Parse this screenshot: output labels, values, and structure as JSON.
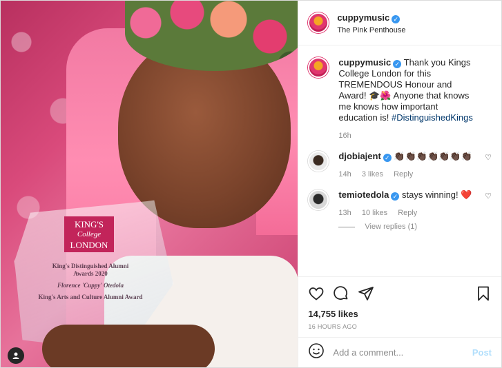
{
  "header": {
    "username": "cuppymusic",
    "location": "The Pink Penthouse"
  },
  "photo": {
    "kings_lines": [
      "KING'S",
      "College",
      "LONDON"
    ],
    "plate_lines": [
      "King's Distinguished Alumni",
      "Awards 2020",
      "Florence 'Cuppy' Otedola",
      "King's Arts and Culture Alumni Award"
    ]
  },
  "caption": {
    "username": "cuppymusic",
    "text": "Thank you Kings College London for this TREMENDOUS Honour and Award! 🎓🌺 Anyone that knows me knows how important education is!",
    "hashtag": "#DistinguishedKings",
    "time": "16h"
  },
  "comments": [
    {
      "username": "djobiajent",
      "text": "👏🏿👏🏿👏🏿👏🏿👏🏿👏🏿👏🏿",
      "time": "14h",
      "likes": "3 likes",
      "reply": "Reply"
    },
    {
      "username": "temiotedola",
      "text": "stays winning! ❤️",
      "time": "13h",
      "likes": "10 likes",
      "reply": "Reply",
      "view_replies": "View replies (1)"
    }
  ],
  "actions": {
    "likes": "14,755 likes",
    "posted_ago": "16 HOURS AGO"
  },
  "add_comment": {
    "placeholder": "Add a comment...",
    "post_label": "Post"
  },
  "colors": {
    "verified": "#3897f0",
    "post_disabled": "#b2dffc",
    "hashtag": "#00376b"
  },
  "icons": [
    "heart-icon",
    "comment-icon",
    "share-icon",
    "bookmark-icon",
    "emoji-icon",
    "user-tag-icon",
    "verified-icon"
  ]
}
